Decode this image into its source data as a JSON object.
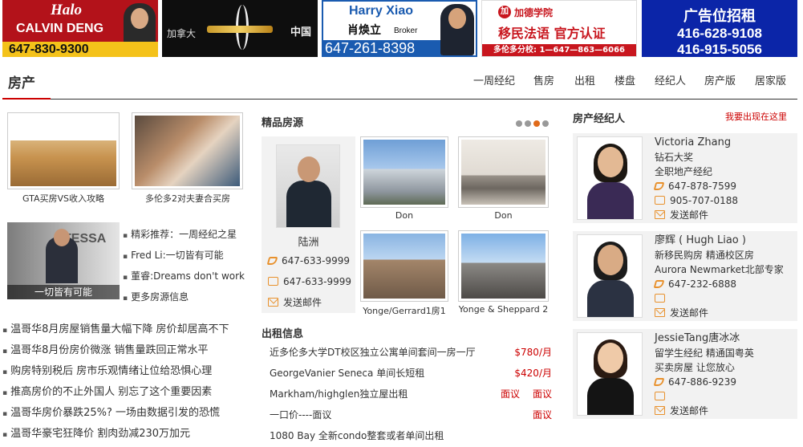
{
  "ads": {
    "ad1": {
      "title": "Halo",
      "name": "CALVIN DENG",
      "phone": "647-830-9300"
    },
    "ad2": {
      "left": "加拿大",
      "right": "中国"
    },
    "ad3": {
      "name_en": "Harry Xiao",
      "name_cn": "肖焕立",
      "role": "Broker",
      "phone": "647-261-8398"
    },
    "ad4": {
      "logo": "加",
      "org": "加德学院",
      "slogan": "移民法语  官方认证",
      "hotline": "多伦多分校: 1—647—863—6066"
    },
    "ad5": {
      "title": "广告位招租",
      "phone1": "416-628-9108",
      "phone2": "416-915-5056"
    }
  },
  "header": {
    "title": "房产",
    "nav": [
      "一周经纪",
      "售房",
      "出租",
      "楼盘",
      "经纪人",
      "房产版",
      "居家版"
    ]
  },
  "left": {
    "thumbs": [
      {
        "caption": "GTA买房VS收入攻略"
      },
      {
        "caption": "多伦多2对夫妻合买房"
      }
    ],
    "feature_caption": "一切皆有可能",
    "feature_sign": "TESSA",
    "bullets": [
      "精彩推荐：一周经纪之星",
      "Fred Li:一切皆有可能",
      "董睿:Dreams don't work",
      "更多房源信息"
    ],
    "news": [
      "温哥华8月房屋销售量大幅下降 房价却居高不下",
      "温哥华8月份房价微涨 销售量跌回正常水平",
      "购房特别税后 房市乐观情绪让位给恐惧心理",
      "推高房价的不止外国人 别忘了这个重要因素",
      "温哥华房价暴跌25%? 一场由数据引发的恐慌",
      "温哥华豪宅狂降价 割肉劲减230万加元"
    ]
  },
  "middle": {
    "featured_title": "精品房源",
    "agent": {
      "name": "陆洲",
      "phone1": "647-633-9999",
      "phone2": "647-633-9999",
      "mail": "发送邮件"
    },
    "props": [
      {
        "caption": "Don"
      },
      {
        "caption": "Don"
      },
      {
        "caption": "Yonge/Gerrard1房1"
      },
      {
        "caption": "Yonge & Sheppard 2"
      }
    ],
    "rent_title": "出租信息",
    "rentals": [
      {
        "title": "近多伦多大学DT校区独立公寓单间套间一房一厅",
        "price": "$780/月"
      },
      {
        "title": "GeorgeVanier Seneca 单间长短租",
        "price": "$420/月"
      },
      {
        "title": "Markham/highglen独立屋出租",
        "price": "面议",
        "price2": "面议"
      },
      {
        "title": "一口价----面议",
        "price": "面议"
      },
      {
        "title": "1080 Bay 全新condo整套或者单间出租",
        "price": ""
      }
    ]
  },
  "right": {
    "title": "房产经纪人",
    "link": "我要出现在这里",
    "agents": [
      {
        "name": "Victoria Zhang",
        "line1": "钻石大奖",
        "line2": "全职地产经纪",
        "phone1": "647-878-7599",
        "phone2": "905-707-0188",
        "mail": "发送邮件"
      },
      {
        "name": "廖辉 ( Hugh Liao )",
        "line1": "新移民购房 精通校区房",
        "line2": "Aurora Newmarket北部专家",
        "phone1": "647-232-6888",
        "phone2": "",
        "mail": "发送邮件"
      },
      {
        "name": "JessieTang唐冰冰",
        "line1": "留学生经纪 精通国粤英",
        "line2": "买卖房屋    让您放心",
        "phone1": "647-886-9239",
        "phone2": "",
        "mail": "发送邮件"
      }
    ]
  }
}
